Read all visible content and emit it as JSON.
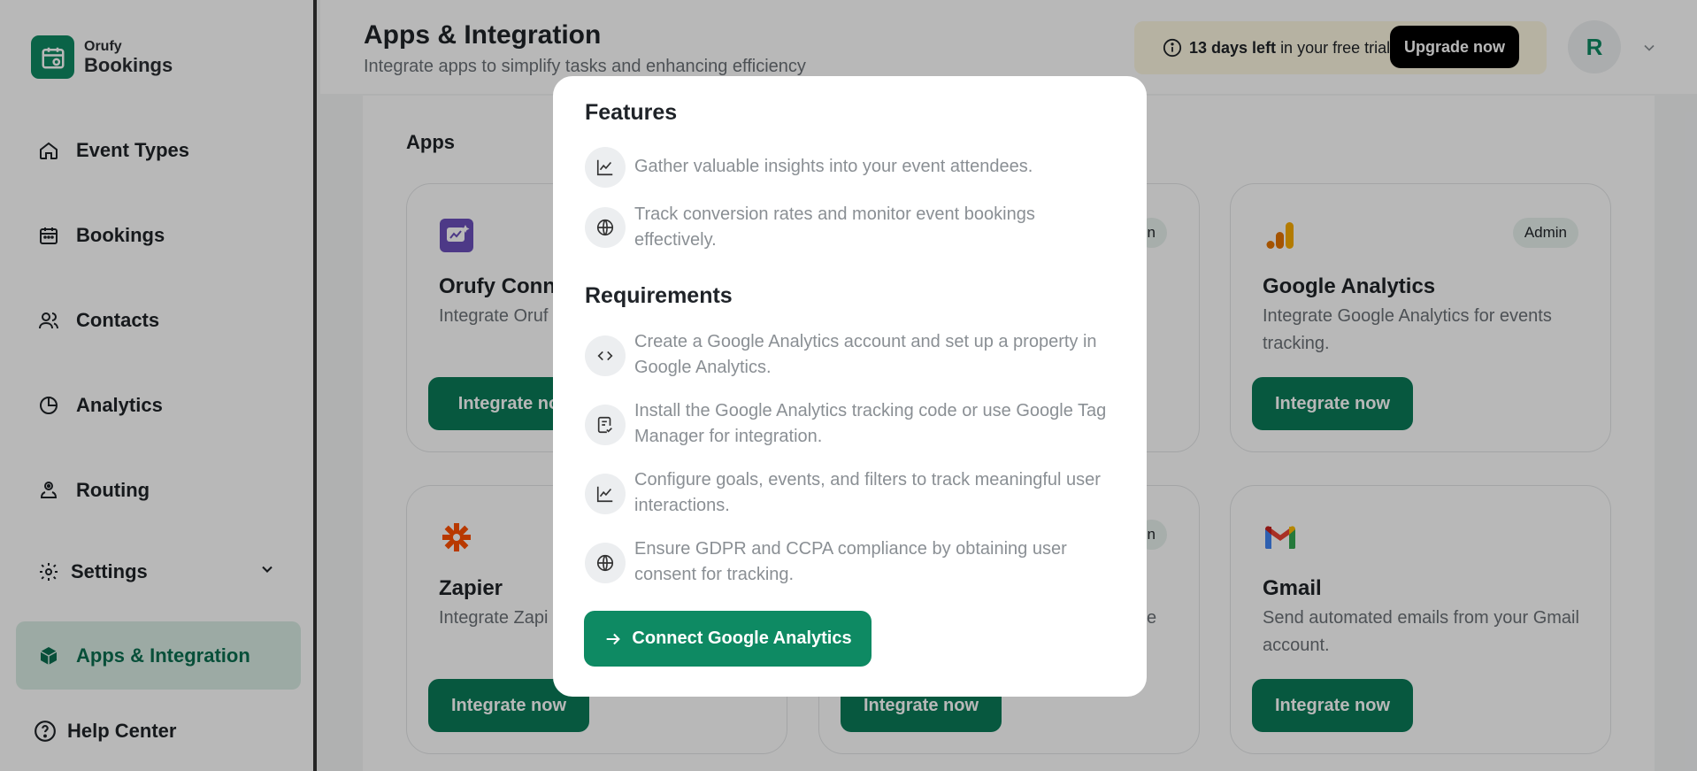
{
  "sidebar": {
    "brand": {
      "top": "Orufy",
      "bottom": "Bookings"
    },
    "items": [
      {
        "label": "Event Types",
        "icon": "home-icon"
      },
      {
        "label": "Bookings",
        "icon": "calendar-icon"
      },
      {
        "label": "Contacts",
        "icon": "users-icon"
      },
      {
        "label": "Analytics",
        "icon": "pie-chart-icon"
      },
      {
        "label": "Routing",
        "icon": "routing-icon"
      },
      {
        "label": "Settings",
        "icon": "gear-icon"
      },
      {
        "label": "Apps & Integration",
        "icon": "box-icon"
      },
      {
        "label": "Help Center",
        "icon": "help-icon"
      }
    ]
  },
  "header": {
    "title": "Apps & Integration",
    "subtitle": "Integrate apps to simplify tasks and enhancing efficiency",
    "trial_days": "13 days left",
    "trial_rest": "in your free trial",
    "upgrade_label": "Upgrade now",
    "avatar_initial": "R"
  },
  "main": {
    "section_title": "Apps",
    "cards": [
      {
        "title": "Orufy Conne",
        "desc": "Integrate Oruf with your cust",
        "button": "Integrate no",
        "badge": ""
      },
      {
        "title": "",
        "desc": "",
        "button": "",
        "badge": "n"
      },
      {
        "title": "Google Analytics",
        "desc": "Integrate Google Analytics for events tracking.",
        "button": "Integrate now",
        "badge": "Admin"
      },
      {
        "title": "Zapier",
        "desc": "Integrate Zapi without any d",
        "button": "Integrate now",
        "badge": ""
      },
      {
        "title": "",
        "desc": "e",
        "button": "Integrate now",
        "badge": "n"
      },
      {
        "title": "Gmail",
        "desc": "Send automated emails from your Gmail account.",
        "button": "Integrate now",
        "badge": ""
      }
    ]
  },
  "modal": {
    "features_title": "Features",
    "features": [
      {
        "text": "Gather valuable insights into your event attendees.",
        "icon": "line-chart-icon"
      },
      {
        "text": "Track conversion rates and monitor event bookings effectively.",
        "icon": "globe-icon"
      }
    ],
    "requirements_title": "Requirements",
    "requirements": [
      {
        "text": "Create a Google Analytics account and set up a property in Google Analytics.",
        "icon": "code-icon"
      },
      {
        "text": "Install the Google Analytics tracking code or use Google Tag Manager for integration.",
        "icon": "document-check-icon"
      },
      {
        "text": "Configure goals, events, and filters to track meaningful user interactions.",
        "icon": "line-chart-icon"
      },
      {
        "text": "Ensure GDPR and CCPA compliance by obtaining user consent for tracking.",
        "icon": "globe-icon"
      }
    ],
    "connect_label": "Connect Google Analytics"
  },
  "colors": {
    "brand_green": "#0e8a63",
    "button_green": "#0b7a58",
    "active_nav_bg": "#d9ece3",
    "upgrade_bg": "#000000",
    "trial_bg": "#fdf7e1"
  }
}
